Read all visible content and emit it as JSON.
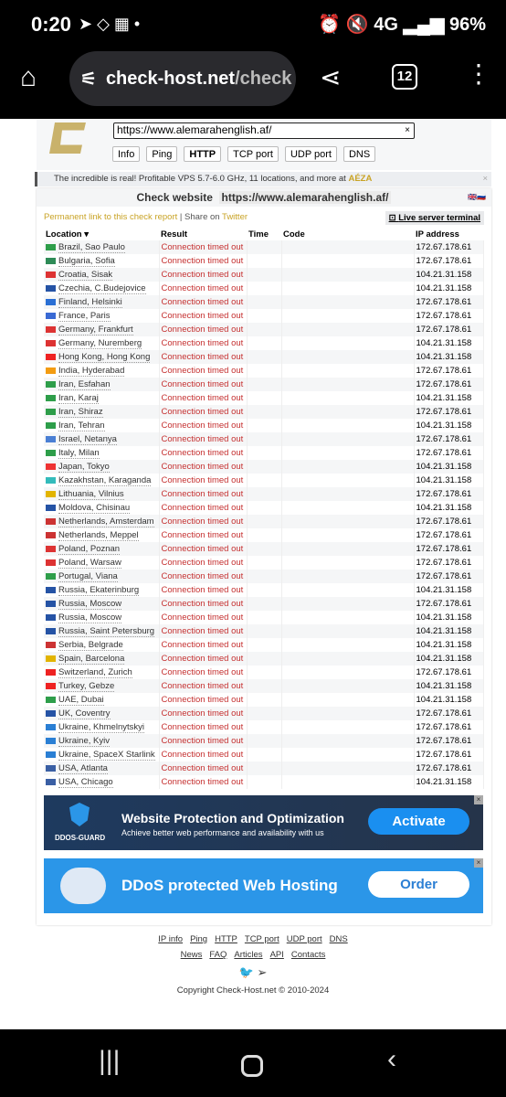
{
  "status_bar": {
    "time": "0:20",
    "battery": "96%",
    "network": "4G"
  },
  "browser": {
    "domain": "check-host.net",
    "path": "/check",
    "tab_count": "12"
  },
  "search": {
    "url": "https://www.alemarahenglish.af/",
    "clear": "×"
  },
  "tools": [
    "Info",
    "Ping",
    "HTTP",
    "TCP port",
    "UDP port",
    "DNS"
  ],
  "active_tool": "HTTP",
  "promo": {
    "text": "The incredible is real! Profitable VPS 5.7-6.0 GHz, 11 locations, and more at ",
    "brand": "AÉZA"
  },
  "check": {
    "title": "Check website",
    "url": "https://www.alemarahenglish.af/",
    "permalink": "Permanent link to this check report",
    "sep": " | Share on ",
    "twitter": "Twitter",
    "terminal": "Live server terminal"
  },
  "table": {
    "headers": [
      "Location ▾",
      "Result",
      "Time",
      "Code",
      "IP address"
    ],
    "rows": [
      [
        "Brazil, Sao Paulo",
        "172.67.178.61",
        "#2e9e4a"
      ],
      [
        "Bulgaria, Sofia",
        "172.67.178.61",
        "#2e8b57"
      ],
      [
        "Croatia, Sisak",
        "104.21.31.158",
        "#d33"
      ],
      [
        "Czechia, C.Budejovice",
        "104.21.31.158",
        "#2553a5"
      ],
      [
        "Finland, Helsinki",
        "172.67.178.61",
        "#2a6fd4"
      ],
      [
        "France, Paris",
        "172.67.178.61",
        "#3a6ad4"
      ],
      [
        "Germany, Frankfurt",
        "172.67.178.61",
        "#d33"
      ],
      [
        "Germany, Nuremberg",
        "104.21.31.158",
        "#d33"
      ],
      [
        "Hong Kong, Hong Kong",
        "104.21.31.158",
        "#e22"
      ],
      [
        "India, Hyderabad",
        "172.67.178.61",
        "#f39c12"
      ],
      [
        "Iran, Esfahan",
        "172.67.178.61",
        "#2e9e4a"
      ],
      [
        "Iran, Karaj",
        "104.21.31.158",
        "#2e9e4a"
      ],
      [
        "Iran, Shiraz",
        "172.67.178.61",
        "#2e9e4a"
      ],
      [
        "Iran, Tehran",
        "104.21.31.158",
        "#2e9e4a"
      ],
      [
        "Israel, Netanya",
        "172.67.178.61",
        "#4a7fd4"
      ],
      [
        "Italy, Milan",
        "172.67.178.61",
        "#2e9e4a"
      ],
      [
        "Japan, Tokyo",
        "104.21.31.158",
        "#e33"
      ],
      [
        "Kazakhstan, Karaganda",
        "104.21.31.158",
        "#3bb"
      ],
      [
        "Lithuania, Vilnius",
        "172.67.178.61",
        "#e2b400"
      ],
      [
        "Moldova, Chisinau",
        "104.21.31.158",
        "#2553a5"
      ],
      [
        "Netherlands, Amsterdam",
        "172.67.178.61",
        "#c33"
      ],
      [
        "Netherlands, Meppel",
        "172.67.178.61",
        "#c33"
      ],
      [
        "Poland, Poznan",
        "172.67.178.61",
        "#d33"
      ],
      [
        "Poland, Warsaw",
        "172.67.178.61",
        "#d33"
      ],
      [
        "Portugal, Viana",
        "172.67.178.61",
        "#2e9e4a"
      ],
      [
        "Russia, Ekaterinburg",
        "104.21.31.158",
        "#2553a5"
      ],
      [
        "Russia, Moscow",
        "172.67.178.61",
        "#2553a5"
      ],
      [
        "Russia, Moscow",
        "104.21.31.158",
        "#2553a5"
      ],
      [
        "Russia, Saint Petersburg",
        "104.21.31.158",
        "#2553a5"
      ],
      [
        "Serbia, Belgrade",
        "104.21.31.158",
        "#c33"
      ],
      [
        "Spain, Barcelona",
        "104.21.31.158",
        "#e2b400"
      ],
      [
        "Switzerland, Zurich",
        "172.67.178.61",
        "#e22"
      ],
      [
        "Turkey, Gebze",
        "104.21.31.158",
        "#e22"
      ],
      [
        "UAE, Dubai",
        "104.21.31.158",
        "#2e9e4a"
      ],
      [
        "UK, Coventry",
        "172.67.178.61",
        "#2553a5"
      ],
      [
        "Ukraine, Khmelnytskyi",
        "172.67.178.61",
        "#2a7fd4"
      ],
      [
        "Ukraine, Kyiv",
        "172.67.178.61",
        "#2a7fd4"
      ],
      [
        "Ukraine, SpaceX Starlink",
        "172.67.178.61",
        "#2a7fd4"
      ],
      [
        "USA, Atlanta",
        "172.67.178.61",
        "#3a5fa4"
      ],
      [
        "USA, Chicago",
        "104.21.31.158",
        "#3a5fa4"
      ]
    ],
    "result": "Connection timed out"
  },
  "ads": {
    "ad1": {
      "brand": "DDOS-GUARD",
      "title": "Website Protection and Optimization",
      "sub": "Achieve better web performance and availability with us",
      "button": "Activate"
    },
    "ad2": {
      "title": "DDoS protected Web Hosting",
      "button": "Order"
    },
    "close": "×"
  },
  "footer": {
    "row1": [
      "IP info",
      "Ping",
      "HTTP",
      "TCP port",
      "UDP port",
      "DNS"
    ],
    "row2": [
      "News",
      "FAQ",
      "Articles",
      "API",
      "Contacts"
    ],
    "copyright": "Copyright Check-Host.net © 2010-2024"
  }
}
